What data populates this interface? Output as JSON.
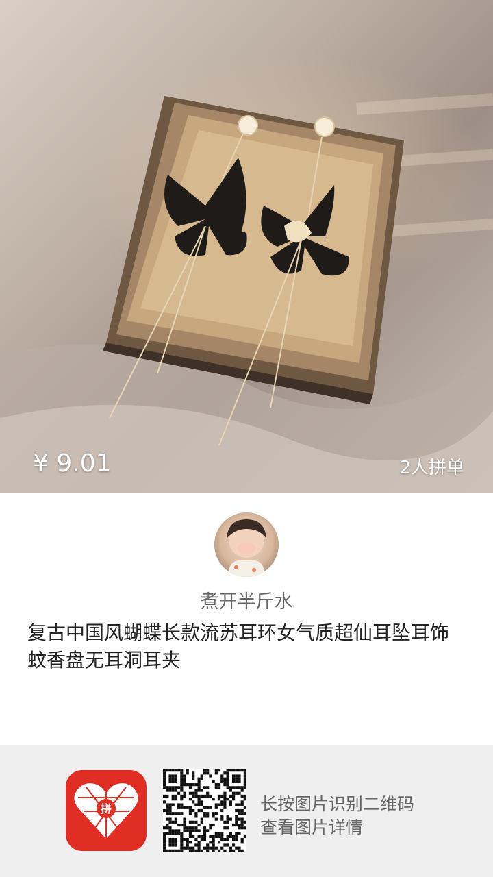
{
  "product": {
    "price": "¥ 9.01",
    "group_count": "2人拼单",
    "title": "复古中国风蝴蝶长款流苏耳环女气质超仙耳坠耳饰蚊香盘无耳洞耳夹"
  },
  "seller": {
    "name": "煮开半斤水"
  },
  "footer": {
    "app_logo_text": "拼",
    "qr_hint_line1": "长按图片识别二维码",
    "qr_hint_line2": "查看图片详情"
  },
  "icons": {
    "app_logo": "pinduoduo-logo-icon",
    "qr": "qr-code-icon"
  }
}
